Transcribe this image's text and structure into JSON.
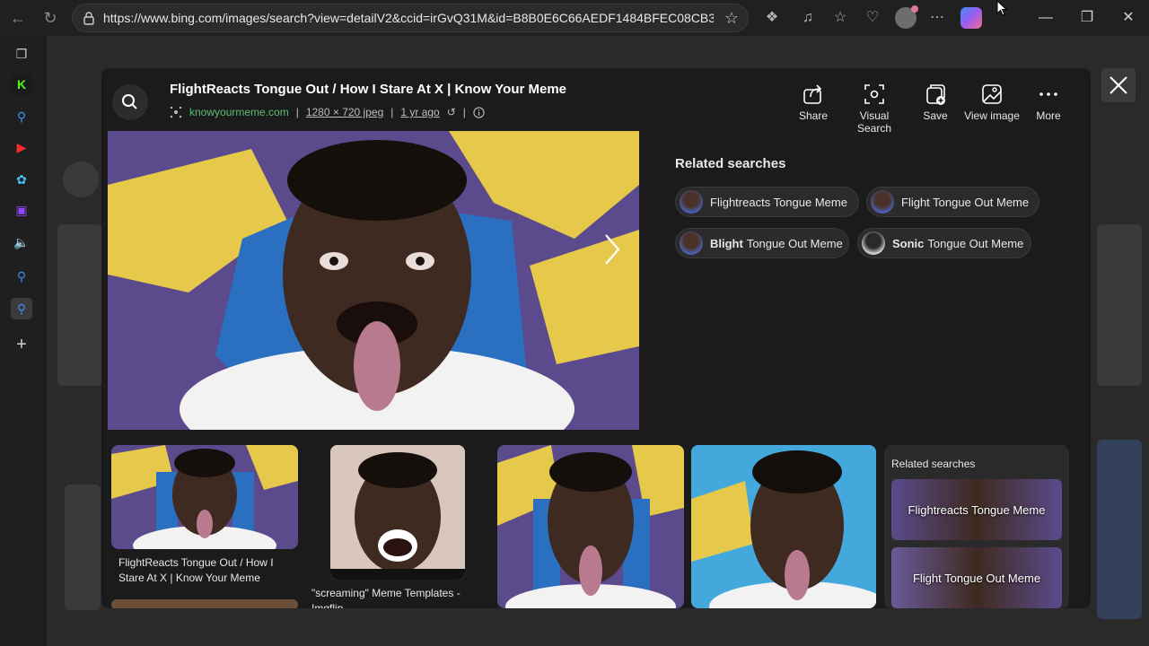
{
  "browser": {
    "url": "https://www.bing.com/images/search?view=detailV2&ccid=irGvQ31M&id=B8B0E6C66AEDF1484BFEC08CB3..."
  },
  "viewer": {
    "title": "FlightReacts Tongue Out / How I Stare At X | Know Your Meme",
    "source": "knowyourmeme.com",
    "separator": "|",
    "dimensions": "1280 × 720 jpeg",
    "age": "1 yr ago",
    "actions": [
      {
        "label": "Share",
        "icon": "share-icon"
      },
      {
        "label": "Visual Search",
        "icon": "visual-search-icon"
      },
      {
        "label": "Save",
        "icon": "save-icon"
      },
      {
        "label": "View image",
        "icon": "image-icon"
      },
      {
        "label": "More",
        "icon": "more-icon"
      }
    ],
    "related_title": "Related searches",
    "related": [
      {
        "bold": "",
        "text": "Flightreacts Tongue Meme"
      },
      {
        "bold": "",
        "text": "Flight Tongue Out Meme"
      },
      {
        "bold": "Blight",
        "text": "Tongue Out Meme"
      },
      {
        "bold": "Sonic",
        "text": "Tongue Out Meme"
      }
    ],
    "results": [
      {
        "caption": "FlightReacts Tongue Out / How I Stare At X | Know Your Meme"
      },
      {
        "caption": "\"screaming\" Meme Templates - Imgflip"
      }
    ],
    "side_panel": {
      "title": "Related searches",
      "cards": [
        "Flightreacts Tongue Meme",
        "Flight Tongue Out Meme"
      ]
    }
  },
  "colors": {
    "modal_bg": "#1b1b1b",
    "source_green": "#5fbf74",
    "purple": "#5a4b8a",
    "yellow": "#e8c94a"
  }
}
